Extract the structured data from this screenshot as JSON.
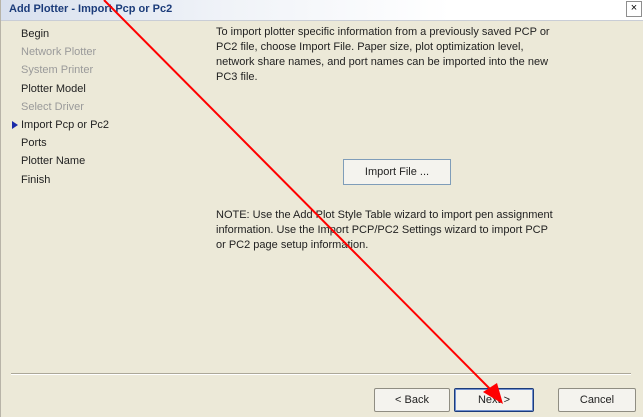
{
  "window": {
    "title": "Add Plotter - Import Pcp or Pc2",
    "close_glyph": "×"
  },
  "steps": [
    {
      "label": "Begin",
      "state": "normal"
    },
    {
      "label": "Network Plotter",
      "state": "disabled"
    },
    {
      "label": "System Printer",
      "state": "disabled"
    },
    {
      "label": "Plotter Model",
      "state": "normal"
    },
    {
      "label": "Select Driver",
      "state": "disabled"
    },
    {
      "label": "Import Pcp or Pc2",
      "state": "current"
    },
    {
      "label": "Ports",
      "state": "normal"
    },
    {
      "label": "Plotter Name",
      "state": "normal"
    },
    {
      "label": "Finish",
      "state": "normal"
    }
  ],
  "content": {
    "intro": "To import plotter specific information from a previously saved PCP or PC2 file, choose Import File. Paper size, plot optimization level, network share names, and port names can be imported into the new PC3 file.",
    "import_button": "Import File ...",
    "note": "NOTE: Use the Add Plot Style Table wizard to import pen assignment information. Use the Import PCP/PC2 Settings wizard to import PCP or PC2 page setup information."
  },
  "footer": {
    "back": "< Back",
    "next": "Next >",
    "cancel": "Cancel"
  },
  "annotation": {
    "color": "#ff0000",
    "icon": "red-annotation-arrow"
  }
}
